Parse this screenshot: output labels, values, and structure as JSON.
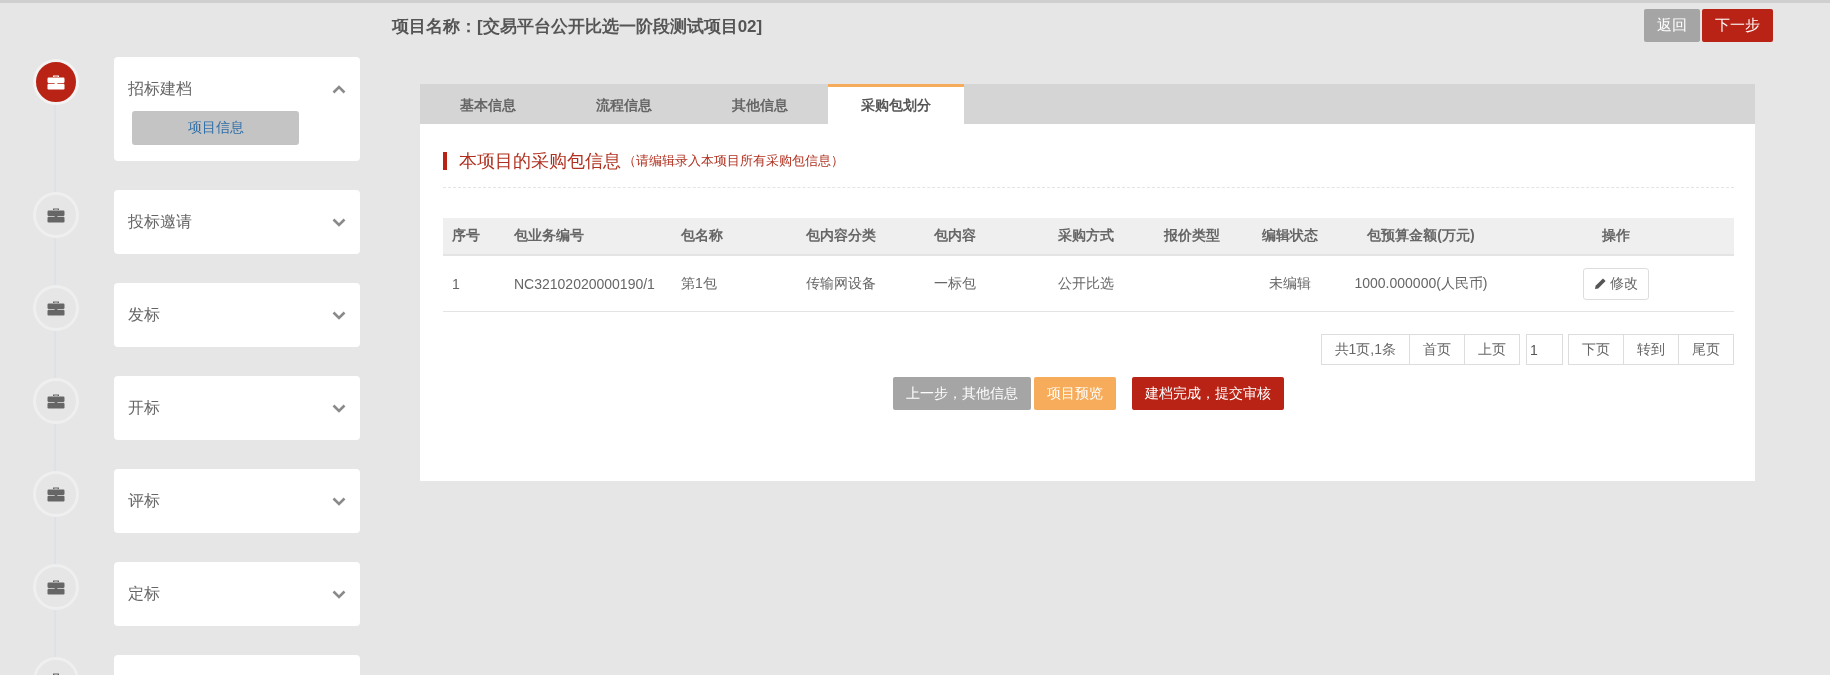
{
  "page_title": "项目名称：[交易平台公开比选一阶段测试项目02]",
  "header_buttons": [
    {
      "label": "返回",
      "kind": "secondary"
    },
    {
      "label": "下一步",
      "kind": "primary"
    }
  ],
  "steps": [
    {
      "label": "招标建档",
      "current": true,
      "expanded": true,
      "children": [
        {
          "label": "项目信息",
          "selected": true
        }
      ]
    },
    {
      "label": "投标邀请",
      "current": false,
      "expanded": false
    },
    {
      "label": "发标",
      "current": false,
      "expanded": false
    },
    {
      "label": "开标",
      "current": false,
      "expanded": false
    },
    {
      "label": "评标",
      "current": false,
      "expanded": false
    },
    {
      "label": "定标",
      "current": false,
      "expanded": false
    },
    {
      "current": false
    }
  ],
  "tabs": [
    {
      "label": "基本信息",
      "selected": false
    },
    {
      "label": "流程信息",
      "selected": false
    },
    {
      "label": "其他信息",
      "selected": false
    },
    {
      "label": "采购包划分",
      "selected": true
    }
  ],
  "section": {
    "title": "本项目的采购包信息",
    "hint": "（请编辑录入本项目所有采购包信息）"
  },
  "table": {
    "columns": [
      "序号",
      "包业务编号",
      "包名称",
      "包内容分类",
      "包内容",
      "采购方式",
      "报价类型",
      "编辑状态",
      "包预算金额(万元)",
      "操作"
    ],
    "rows": [
      {
        "cells": [
          "1",
          "NC32102020000190/1",
          "第1包",
          "传输网设备",
          "一标包",
          "公开比选",
          null,
          "未编辑",
          "1000.000000(人民币)"
        ],
        "action": "修改"
      }
    ]
  },
  "pagination": {
    "summary": "共1页,1条",
    "first": "首页",
    "prev": "上页",
    "page": "1",
    "next": "下页",
    "go": "转到",
    "last": "尾页"
  },
  "actions": [
    {
      "label": "上一步，其他信息",
      "kind": "secondary"
    },
    {
      "label": "项目预览",
      "kind": "warning"
    },
    {
      "label": "建档完成，提交审核",
      "kind": "primary"
    }
  ]
}
